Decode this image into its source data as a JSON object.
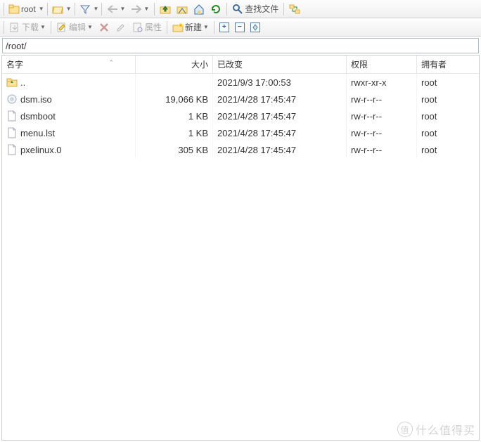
{
  "toolbar1": {
    "folder_label": "root",
    "find_label": "查找文件"
  },
  "toolbar2": {
    "download_label": "下载",
    "edit_label": "编辑",
    "properties_label": "属性",
    "new_label": "新建"
  },
  "path": "/root/",
  "columns": {
    "name": "名字",
    "size": "大小",
    "changed": "已改变",
    "rights": "权限",
    "owner": "拥有者"
  },
  "rows": [
    {
      "icon": "up",
      "name": "..",
      "size": "",
      "changed": "2021/9/3 17:00:53",
      "rights": "rwxr-xr-x",
      "owner": "root"
    },
    {
      "icon": "iso",
      "name": "dsm.iso",
      "size": "19,066 KB",
      "changed": "2021/4/28 17:45:47",
      "rights": "rw-r--r--",
      "owner": "root"
    },
    {
      "icon": "file",
      "name": "dsmboot",
      "size": "1 KB",
      "changed": "2021/4/28 17:45:47",
      "rights": "rw-r--r--",
      "owner": "root"
    },
    {
      "icon": "file",
      "name": "menu.lst",
      "size": "1 KB",
      "changed": "2021/4/28 17:45:47",
      "rights": "rw-r--r--",
      "owner": "root"
    },
    {
      "icon": "file",
      "name": "pxelinux.0",
      "size": "305 KB",
      "changed": "2021/4/28 17:45:47",
      "rights": "rw-r--r--",
      "owner": "root"
    }
  ],
  "watermark": "什么值得买"
}
